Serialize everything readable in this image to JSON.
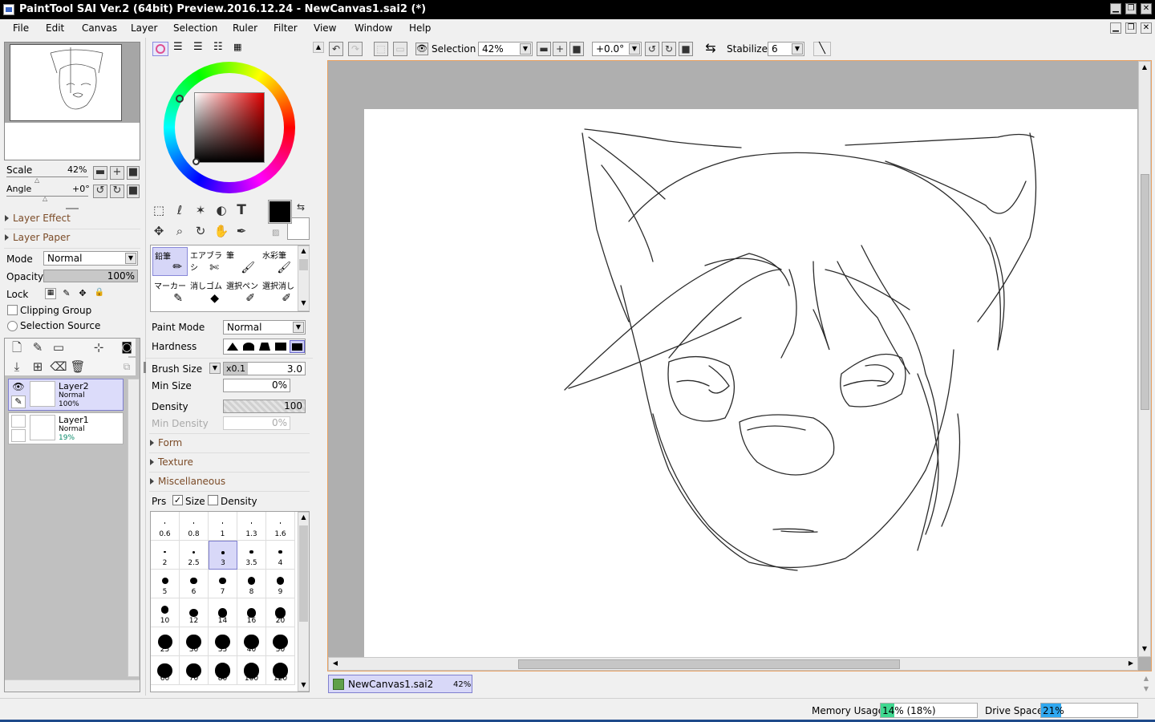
{
  "window": {
    "title": "PaintTool SAI Ver.2 (64bit) Preview.2016.12.24 - NewCanvas1.sai2 (*)"
  },
  "menu": [
    "File",
    "Edit",
    "Canvas",
    "Layer",
    "Selection",
    "Ruler",
    "Filter",
    "View",
    "Window",
    "Help"
  ],
  "navigator": {
    "scale_label": "Scale",
    "scale_value": "42%",
    "angle_label": "Angle",
    "angle_value": "+0°"
  },
  "layer_panel": {
    "sections": [
      "Layer Effect",
      "Layer Paper"
    ],
    "mode_label": "Mode",
    "mode_value": "Normal",
    "opacity_label": "Opacity",
    "opacity_value": "100%",
    "lock_label": "Lock",
    "clipping_group": "Clipping Group",
    "selection_source": "Selection Source",
    "layers": [
      {
        "name": "Layer2",
        "mode": "Normal",
        "opacity": "100%"
      },
      {
        "name": "Layer1",
        "mode": "Normal",
        "opacity": "19%"
      }
    ]
  },
  "tool_panel": {
    "brushes": [
      {
        "label": "鉛筆"
      },
      {
        "label": "エアブラシ"
      },
      {
        "label": "筆"
      },
      {
        "label": "水彩筆"
      },
      {
        "label": "マーカー"
      },
      {
        "label": "消しゴム"
      },
      {
        "label": "選択ペン"
      },
      {
        "label": "選択消し"
      }
    ],
    "paint_mode_label": "Paint Mode",
    "paint_mode_value": "Normal",
    "hardness_label": "Hardness",
    "brush_size_label": "Brush Size",
    "brush_size_mult": "x0.1",
    "brush_size_value": "3.0",
    "min_size_label": "Min Size",
    "min_size_value": "0%",
    "density_label": "Density",
    "density_value": "100",
    "min_density_label": "Min Density",
    "min_density_value": "0%",
    "sections": [
      "Form",
      "Texture",
      "Miscellaneous"
    ],
    "prs_label": "Prs",
    "prs_size": "Size",
    "prs_density": "Density",
    "size_presets": [
      "0.6",
      "0.8",
      "1",
      "1.3",
      "1.6",
      "2",
      "2.5",
      "3",
      "3.5",
      "4",
      "5",
      "6",
      "7",
      "8",
      "9",
      "10",
      "12",
      "14",
      "16",
      "20",
      "25",
      "30",
      "35",
      "40",
      "50",
      "60",
      "70",
      "80",
      "100",
      "120"
    ],
    "selected_preset": "3"
  },
  "canvas_toolbar": {
    "selection_label": "Selection",
    "zoom_value": "42%",
    "angle_value": "+0.0°",
    "stabilizer_label": "Stabilizer",
    "stabilizer_value": "6"
  },
  "canvas_tab": {
    "name": "NewCanvas1.sai2",
    "zoom": "42%"
  },
  "status": {
    "memory_label": "Memory Usage",
    "memory_value": "14% (18%)",
    "memory_fraction": 0.14,
    "drive_label": "Drive Space",
    "drive_value": "21%",
    "drive_fraction": 0.21
  },
  "colors": {
    "titlebar": "#000000",
    "selection_highlight": "#d8d8f8",
    "canvas_border": "#e8a060",
    "memory_bar": "#3fd890",
    "drive_bar": "#30a8f0",
    "section_text": "#7b4b27"
  }
}
